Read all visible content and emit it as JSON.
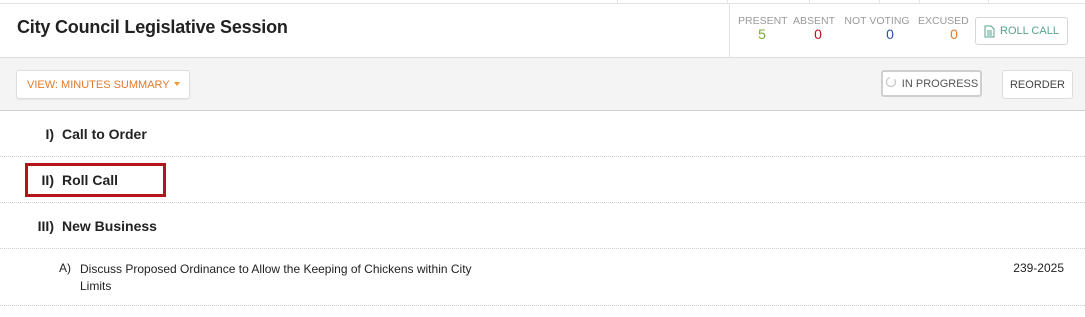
{
  "header": {
    "title": "City Council Legislative Session"
  },
  "attendance": {
    "present": {
      "label": "PRESENT",
      "value": "5",
      "color": "#7aa83a"
    },
    "absent": {
      "label": "ABSENT",
      "value": "0",
      "color": "#b5121b"
    },
    "not_voting": {
      "label": "NOT VOTING",
      "value": "0",
      "color": "#2b4fa3"
    },
    "excused": {
      "label": "EXCUSED",
      "value": "0",
      "color": "#e07a2e"
    }
  },
  "roll_call_button": {
    "label": "ROLL CALL",
    "icon": "document-list-icon"
  },
  "toolbar": {
    "view_label": "VIEW: MINUTES SUMMARY",
    "status_label": "IN PROGRESS",
    "status_icon": "spinner-icon",
    "reorder_label": "REORDER"
  },
  "agenda": [
    {
      "number": "I)",
      "title": "Call to Order"
    },
    {
      "number": "II)",
      "title": "Roll Call"
    },
    {
      "number": "III)",
      "title": "New Business"
    }
  ],
  "sub_items": [
    {
      "number": "A)",
      "title": "Discuss Proposed Ordinance to Allow the Keeping of Chickens within City Limits",
      "reference": "239-2025"
    }
  ],
  "colors": {
    "accent_orange": "#e07a2e",
    "accent_green": "#5aa38c",
    "highlight_red": "#b5121b"
  }
}
